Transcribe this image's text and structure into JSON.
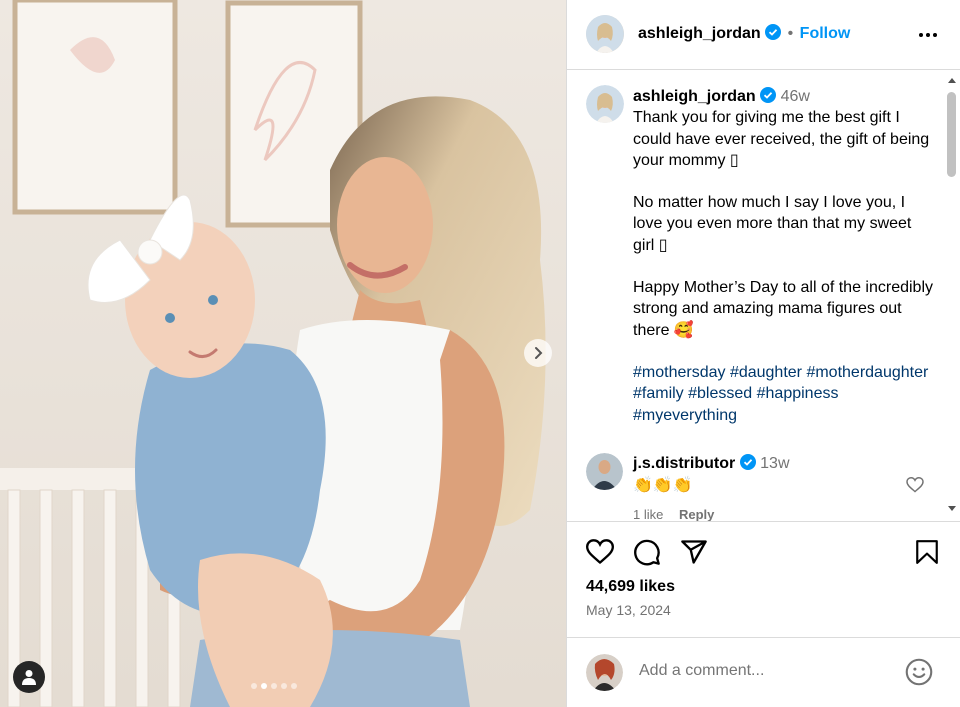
{
  "post": {
    "author": "ashleigh_jordan",
    "follow_separator": "•",
    "follow_label": "Follow",
    "caption_time": "46w",
    "caption_paragraphs": [
      "Thank you for giving me the best gift I could have ever received, the gift of being your mommy ▯",
      "No matter how much I say I love you, I love you even more than that my sweet girl ▯",
      "Happy Mother’s Day to all of the incredibly strong and amazing mama figures out there 🥰"
    ],
    "hashtags": "#mothersday #daughter #motherdaughter #family #blessed #happiness #myeverything",
    "likes": "44,699 likes",
    "date": "May 13, 2024"
  },
  "comment": {
    "author": "j.s.distributor",
    "time": "13w",
    "text": "👏👏👏",
    "likes_label": "1 like",
    "reply_label": "Reply"
  },
  "comment_box": {
    "placeholder": "Add a comment..."
  },
  "carousel": {
    "slide_count": 5,
    "active_slide": 2
  },
  "colors": {
    "accent": "#0095f6",
    "verified": "#0095f6",
    "hashtag": "#00376b",
    "muted": "#737373"
  },
  "icons": [
    "verified-badge-icon",
    "more-options-icon",
    "next-arrow-icon",
    "user-tag-icon",
    "heart-icon",
    "comment-icon",
    "share-icon",
    "bookmark-icon",
    "emoji-icon"
  ]
}
